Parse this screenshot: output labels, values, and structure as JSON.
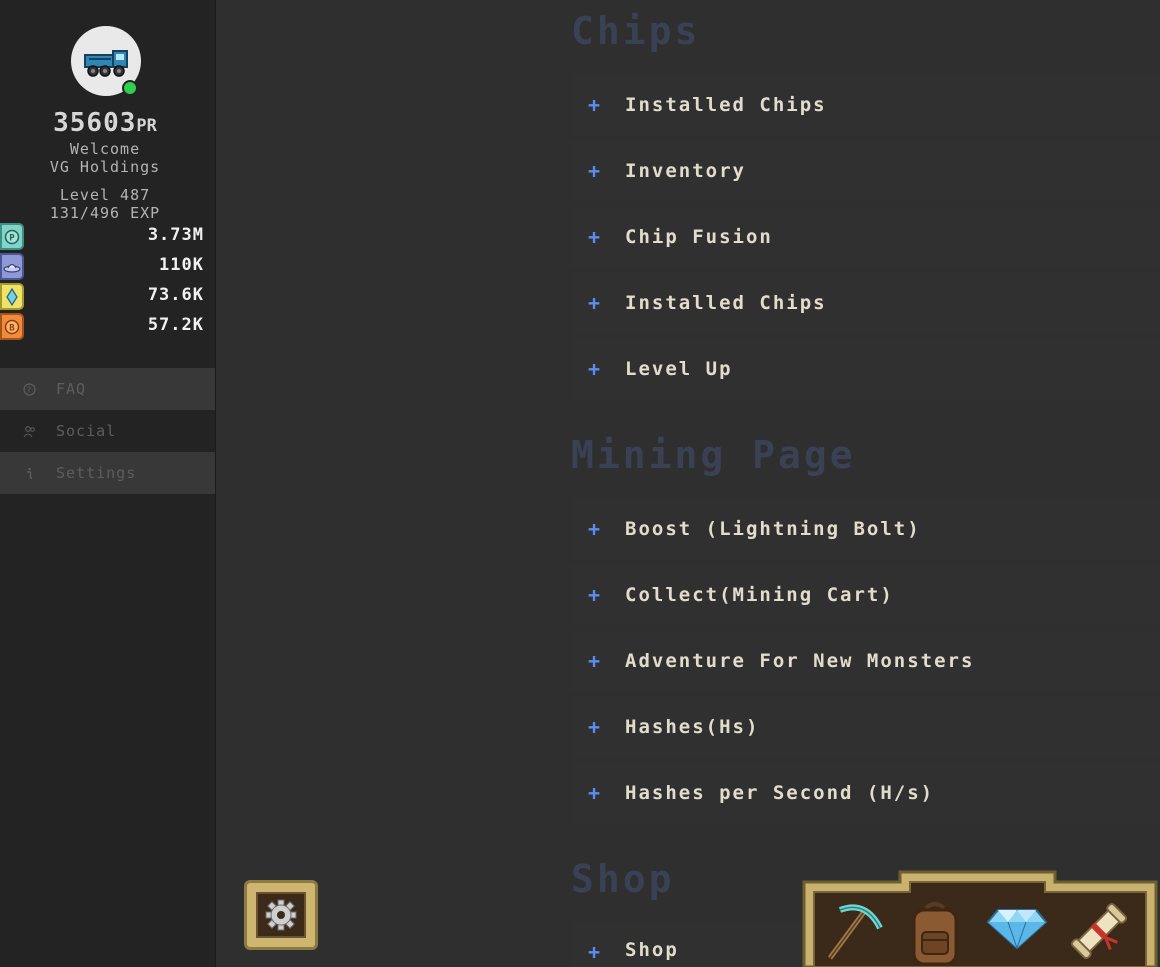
{
  "profile": {
    "pr_value": "35603",
    "pr_unit": "PR",
    "welcome_label": "Welcome",
    "company": "VG Holdings",
    "level_text": "Level 487",
    "exp_text": "131/496 EXP",
    "online_status_color": "#2fcf4c"
  },
  "currencies": [
    {
      "icon": "p-coin-icon",
      "value": "3.73M",
      "color": "#7fd6c8"
    },
    {
      "icon": "ufo-icon",
      "value": "110K",
      "color": "#8f99d6"
    },
    {
      "icon": "crystal-icon",
      "value": "73.6K",
      "color": "#f0e36a"
    },
    {
      "icon": "bitcoin-icon",
      "value": "57.2K",
      "color": "#f08a3c"
    }
  ],
  "nav": {
    "items": [
      {
        "label": "FAQ",
        "icon": "question-icon",
        "active": true
      },
      {
        "label": "Social",
        "icon": "people-icon",
        "active": false
      },
      {
        "label": "Settings",
        "icon": "info-icon",
        "active": true
      }
    ]
  },
  "sections": {
    "chips": {
      "title": "Chips",
      "items": [
        "Installed Chips",
        "Inventory",
        "Chip Fusion",
        "Installed Chips",
        "Level Up"
      ]
    },
    "mining": {
      "title": "Mining Page",
      "items": [
        "Boost (Lightning Bolt)",
        "Collect(Mining Cart)",
        "Adventure For New Monsters",
        "Hashes(Hs)",
        "Hashes per Second (H/s)"
      ]
    },
    "shop": {
      "title": "Shop",
      "items": [
        "Shop"
      ]
    }
  },
  "plus_symbol": "+",
  "toolbar": {
    "tools": [
      "pickaxe-icon",
      "backpack-icon",
      "diamond-icon",
      "scroll-icon"
    ]
  },
  "colors": {
    "accent_plus": "#5b8def",
    "section_title": "#3a4155",
    "frame_gold": "#cfb670"
  }
}
